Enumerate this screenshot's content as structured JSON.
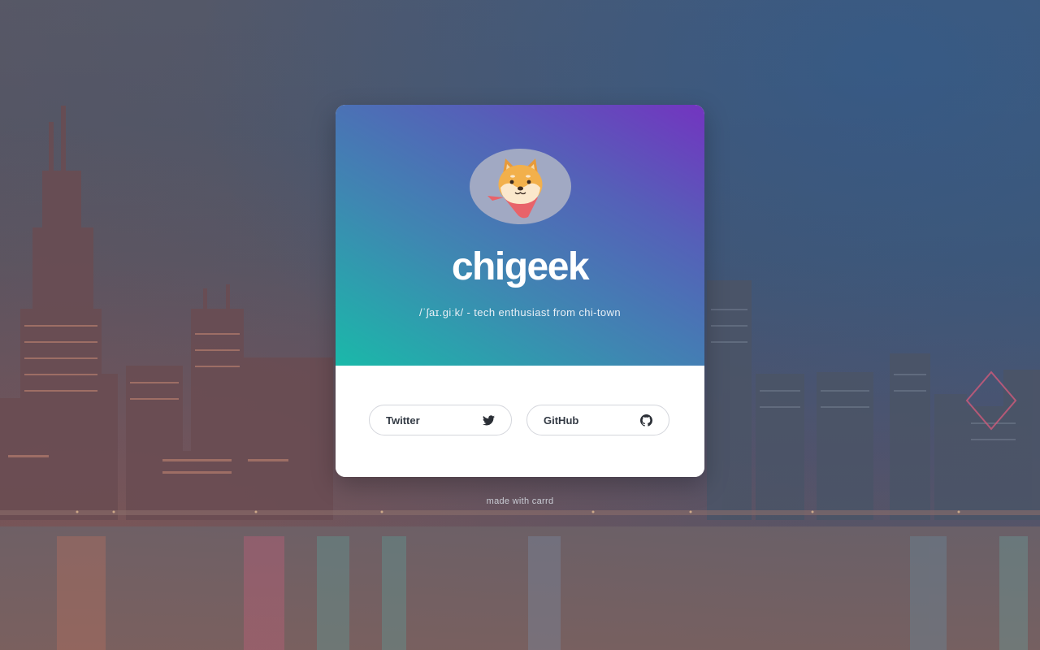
{
  "profile": {
    "name": "chigeek",
    "tagline": "/ˈʃaɪ.giːk/ - tech enthusiast from chi-town",
    "avatar_icon": "shiba-dog-icon"
  },
  "links": [
    {
      "label": "Twitter",
      "icon": "twitter-icon"
    },
    {
      "label": "GitHub",
      "icon": "github-icon"
    }
  ],
  "footer": {
    "text": "made with carrd"
  },
  "colors": {
    "gradient_start": "#1ab9a9",
    "gradient_end": "#7334c0",
    "button_text": "#333a44",
    "card_bottom": "#ffffff"
  }
}
